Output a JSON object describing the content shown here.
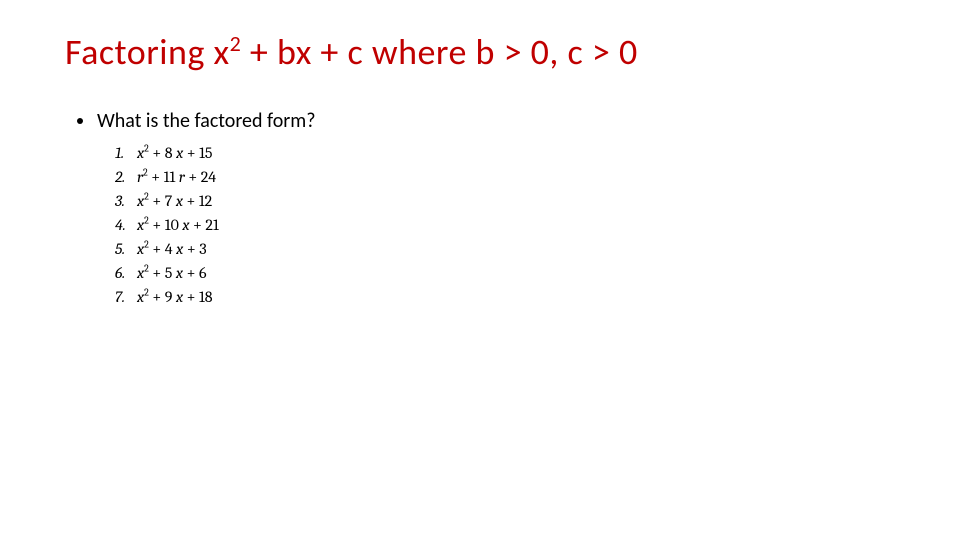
{
  "title": {
    "prefix": "Factoring x",
    "sup": "2",
    "suffix": " + bx + c where b > 0, c > 0"
  },
  "question": "What is the factored form?",
  "items": [
    {
      "num": "1.",
      "var": "x",
      "b": "8",
      "c": "15"
    },
    {
      "num": "2.",
      "var": "r",
      "b": "11",
      "c": "24"
    },
    {
      "num": "3.",
      "var": "x",
      "b": "7",
      "c": "12"
    },
    {
      "num": "4.",
      "var": "x",
      "b": "10",
      "c": "21"
    },
    {
      "num": "5.",
      "var": "x",
      "b": "4",
      "c": "3"
    },
    {
      "num": "6.",
      "var": "x",
      "b": "5",
      "c": "6"
    },
    {
      "num": "7.",
      "var": "x",
      "b": "9",
      "c": "18"
    }
  ]
}
